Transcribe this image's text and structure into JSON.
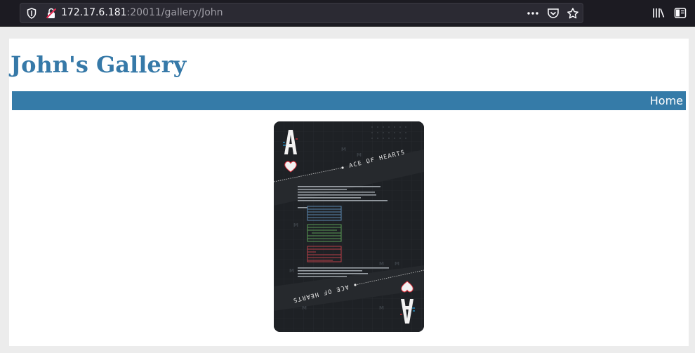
{
  "browser": {
    "url_host": "172.17.6.181",
    "url_rest": ":20011/gallery/John",
    "icons": [
      "shield-icon",
      "insecure-lock-icon",
      "page-actions-icon",
      "pocket-icon",
      "bookmark-star-icon",
      "library-icon",
      "sidebar-icon"
    ]
  },
  "page": {
    "title": "John's Gallery",
    "nav": {
      "home": "Home"
    }
  },
  "gallery": {
    "images": [
      {
        "name": "ace-of-hearts-card",
        "top_caption": "ACE OF HEARTS",
        "bottom_caption": "ACE OF HEARTS",
        "rank": "A"
      }
    ]
  },
  "colors": {
    "accent": "#357ba8",
    "title": "#3679a8",
    "toolbar": "#1c1b22"
  }
}
